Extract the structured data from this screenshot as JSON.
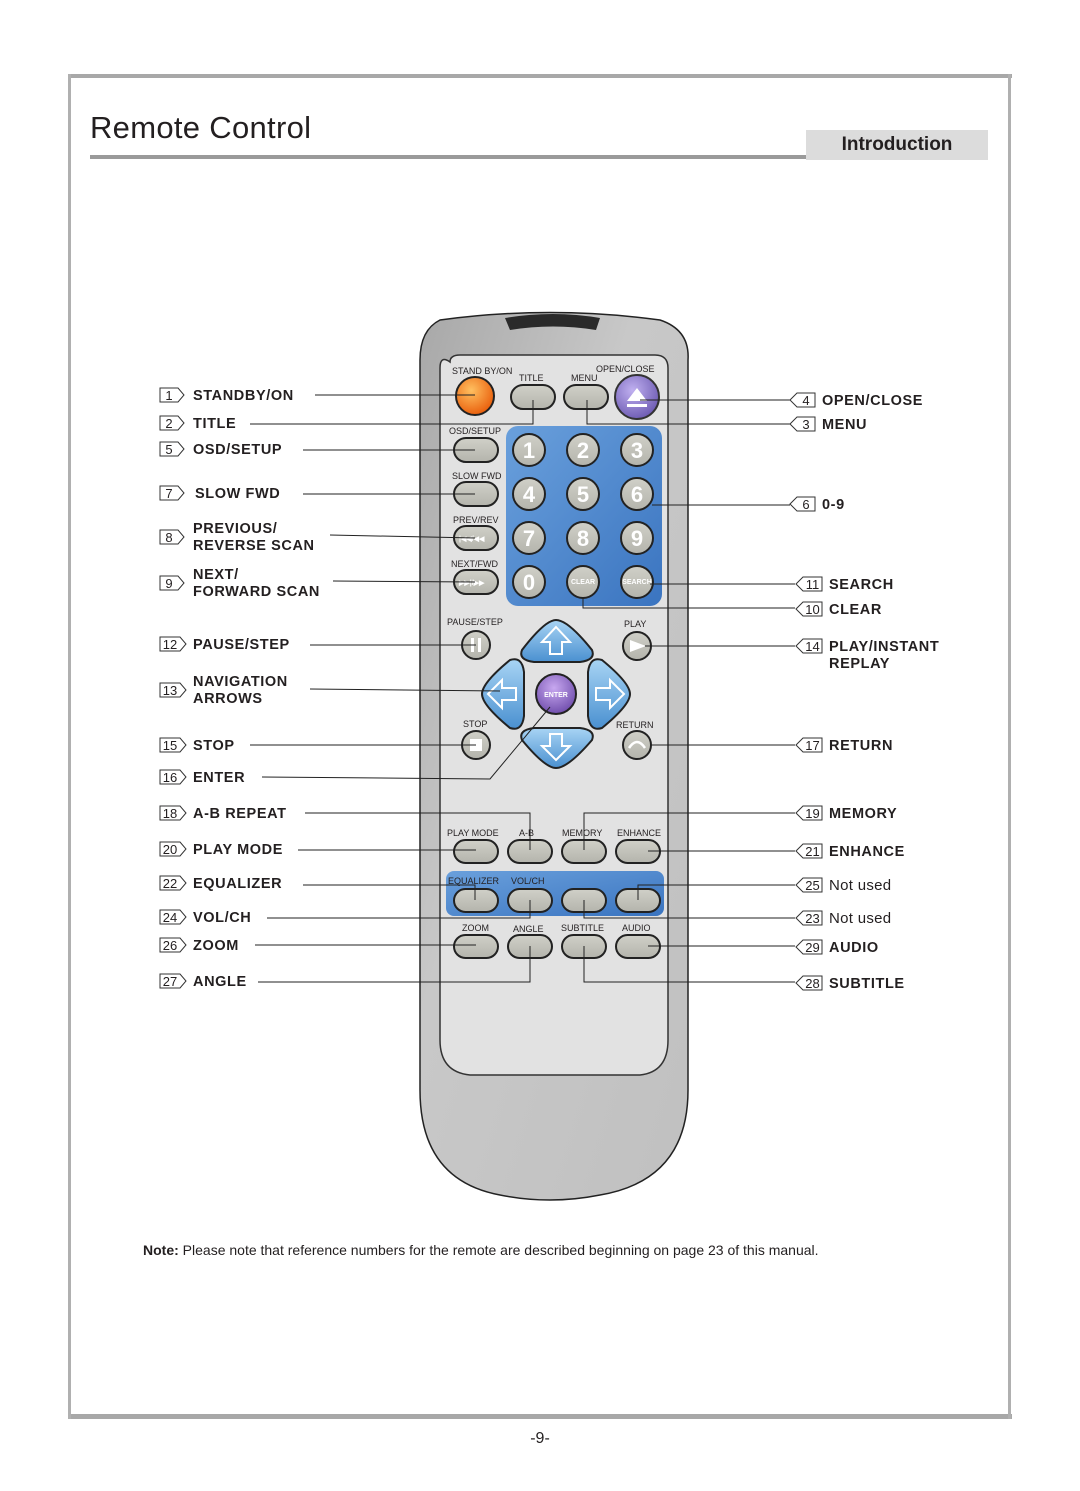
{
  "header": {
    "title": "Remote Control",
    "section": "Introduction"
  },
  "remote": {
    "button_labels": {
      "standby": "STAND BY/ON",
      "title": "TITLE",
      "menu": "MENU",
      "open_close": "OPEN/CLOSE",
      "osd_setup": "OSD/SETUP",
      "slow_fwd": "SLOW FWD",
      "prev_rev": "PREV/REV",
      "next_fwd": "NEXT/FWD",
      "pause_step": "PAUSE/STEP",
      "play": "PLAY",
      "stop": "STOP",
      "return": "RETURN",
      "enter": "ENTER",
      "clear": "CLEAR",
      "search": "SEARCH",
      "play_mode": "PLAY MODE",
      "ab": "A-B",
      "memory": "MEMORY",
      "enhance": "ENHANCE",
      "equalizer": "EQUALIZER",
      "vol_ch": "VOL/CH",
      "zoom": "ZOOM",
      "angle": "ANGLE",
      "subtitle": "SUBTITLE",
      "audio": "AUDIO",
      "prev_glyph": "|◀◀/◀◀",
      "next_glyph": "▶▶|/▶▶"
    },
    "digits": [
      "1",
      "2",
      "3",
      "4",
      "5",
      "6",
      "7",
      "8",
      "9",
      "0"
    ]
  },
  "callouts_left": [
    {
      "num": "1",
      "lines": [
        "STANDBY/ON"
      ]
    },
    {
      "num": "2",
      "lines": [
        "TITLE"
      ]
    },
    {
      "num": "5",
      "lines": [
        "OSD/SETUP"
      ]
    },
    {
      "num": "7",
      "lines": [
        "SLOW FWD"
      ]
    },
    {
      "num": "8",
      "lines": [
        "PREVIOUS/",
        "REVERSE SCAN"
      ]
    },
    {
      "num": "9",
      "lines": [
        "NEXT/",
        "FORWARD SCAN"
      ]
    },
    {
      "num": "12",
      "lines": [
        "PAUSE/STEP"
      ]
    },
    {
      "num": "13",
      "lines": [
        "NAVIGATION",
        "ARROWS"
      ]
    },
    {
      "num": "15",
      "lines": [
        "STOP"
      ]
    },
    {
      "num": "16",
      "lines": [
        "ENTER"
      ]
    },
    {
      "num": "18",
      "lines": [
        "A-B REPEAT"
      ]
    },
    {
      "num": "20",
      "lines": [
        "PLAY MODE"
      ]
    },
    {
      "num": "22",
      "lines": [
        "EQUALIZER"
      ]
    },
    {
      "num": "24",
      "lines": [
        "VOL/CH"
      ]
    },
    {
      "num": "26",
      "lines": [
        "ZOOM"
      ]
    },
    {
      "num": "27",
      "lines": [
        "ANGLE"
      ]
    }
  ],
  "callouts_right": [
    {
      "num": "4",
      "lines": [
        "OPEN/CLOSE"
      ],
      "bold": true
    },
    {
      "num": "3",
      "lines": [
        "MENU"
      ],
      "bold": true
    },
    {
      "num": "6",
      "lines": [
        "0-9"
      ],
      "bold": true
    },
    {
      "num": "11",
      "lines": [
        "SEARCH"
      ],
      "bold": true
    },
    {
      "num": "10",
      "lines": [
        "CLEAR"
      ],
      "bold": true
    },
    {
      "num": "14",
      "lines": [
        "PLAY/INSTANT",
        "REPLAY"
      ],
      "bold": true
    },
    {
      "num": "17",
      "lines": [
        "RETURN"
      ],
      "bold": true
    },
    {
      "num": "19",
      "lines": [
        "MEMORY"
      ],
      "bold": true
    },
    {
      "num": "21",
      "lines": [
        "ENHANCE"
      ],
      "bold": true
    },
    {
      "num": "25",
      "lines": [
        "Not used"
      ],
      "bold": false
    },
    {
      "num": "23",
      "lines": [
        "Not used"
      ],
      "bold": false
    },
    {
      "num": "29",
      "lines": [
        "AUDIO"
      ],
      "bold": true
    },
    {
      "num": "28",
      "lines": [
        "SUBTITLE"
      ],
      "bold": true
    }
  ],
  "note": {
    "label": "Note:",
    "text": " Please note that reference numbers for the remote are described beginning on page 23 of this manual."
  },
  "footer": {
    "page_number": "-9-"
  },
  "colors": {
    "standby": "#f07a14",
    "open_close": "#8a7ac8",
    "keypad_blue": "#4a86cc",
    "nav_arrow": "#7ab8e6",
    "enter": "#8a6ac0",
    "button_gray": "#c4c4bc",
    "body_gray": "#c6c6c6",
    "face_gray": "#e2e2e2"
  }
}
